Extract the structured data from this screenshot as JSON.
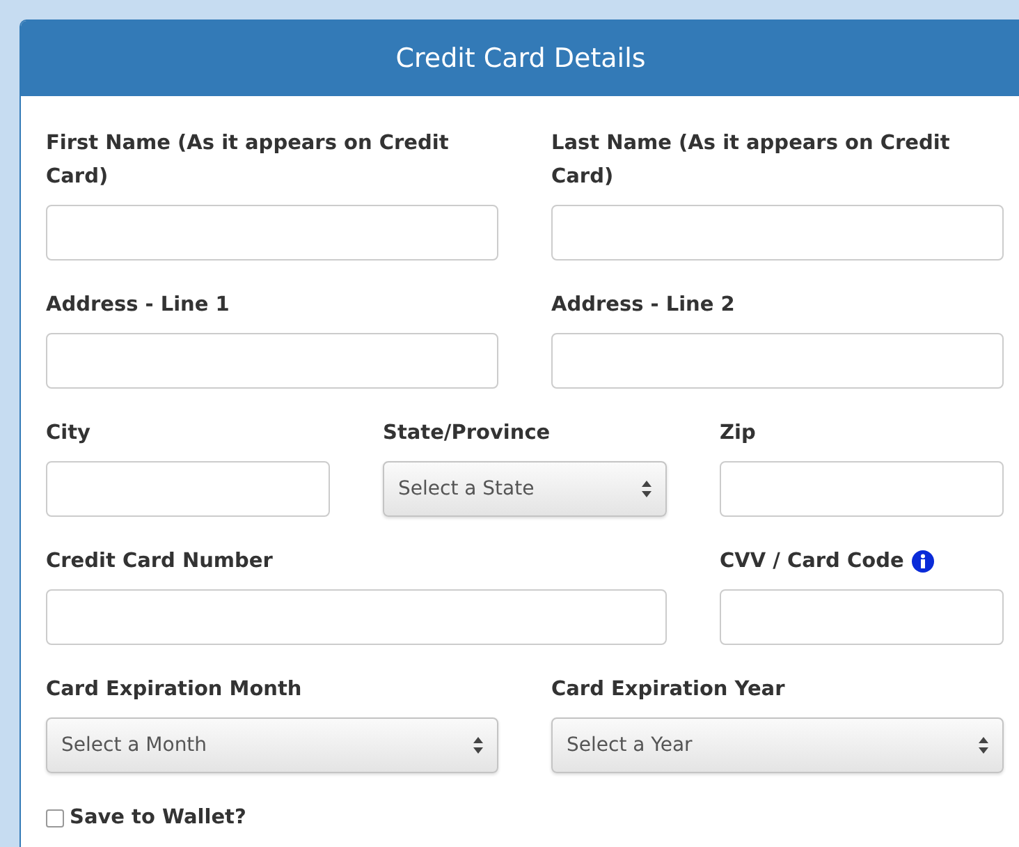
{
  "panel": {
    "title": "Credit Card Details"
  },
  "fields": [
    {
      "kind": "input",
      "label": "First Name (As it appears on Credit Card)"
    },
    {
      "kind": "input",
      "label": "Last Name (As it appears on Credit Card)"
    },
    {
      "kind": "input",
      "label": "Address - Line 1"
    },
    {
      "kind": "input",
      "label": "Address - Line 2"
    },
    {
      "kind": "input",
      "label": "City"
    },
    {
      "kind": "select",
      "label": "State/Province",
      "value": "Select a State"
    },
    {
      "kind": "input",
      "label": "Zip"
    },
    {
      "kind": "input",
      "label": "Credit Card Number"
    },
    {
      "kind": "input",
      "label": "CVV / Card Code",
      "info": true
    },
    {
      "kind": "select",
      "label": "Card Expiration Month",
      "value": "Select a Month"
    },
    {
      "kind": "select",
      "label": "Card Expiration Year",
      "value": "Select a Year"
    }
  ],
  "save_to_wallet": {
    "label": "Save to Wallet?",
    "checked": false
  }
}
